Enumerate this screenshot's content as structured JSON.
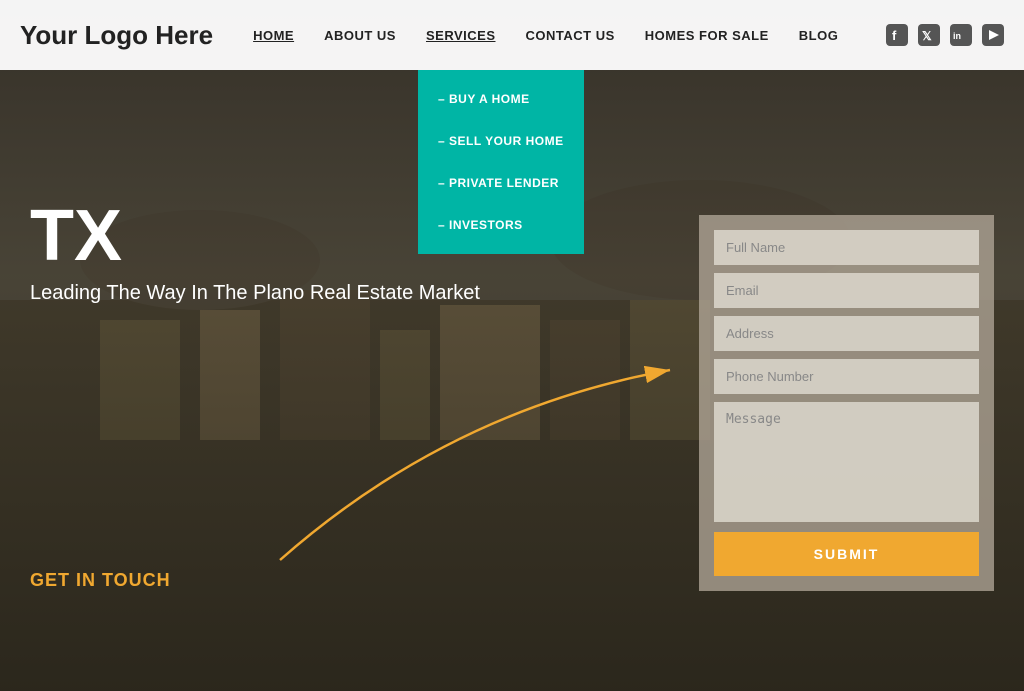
{
  "logo": {
    "text": "Your Logo Here"
  },
  "navbar": {
    "links": [
      {
        "label": "HOME",
        "id": "home",
        "active": true
      },
      {
        "label": "ABOUT US",
        "id": "about"
      },
      {
        "label": "SERVICES",
        "id": "services",
        "underline": true
      },
      {
        "label": "CONTACT US",
        "id": "contact"
      },
      {
        "label": "HOMES FOR SALE",
        "id": "homes"
      },
      {
        "label": "BLOG",
        "id": "blog"
      }
    ],
    "icons": [
      {
        "name": "facebook-icon",
        "symbol": "f"
      },
      {
        "name": "twitter-icon",
        "symbol": "t"
      },
      {
        "name": "linkedin-icon",
        "symbol": "in"
      },
      {
        "name": "youtube-icon",
        "symbol": "▶"
      }
    ]
  },
  "dropdown": {
    "items": [
      {
        "label": "– BUY A HOME"
      },
      {
        "label": "– SELL YOUR HOME"
      },
      {
        "label": "– PRIVATE LENDER"
      },
      {
        "label": "– INVESTORS"
      }
    ]
  },
  "hero": {
    "tx_text": "TX",
    "subtitle": "Leading The Way In The Plano Real Estate Market",
    "cta": "GET IN TOUCH"
  },
  "form": {
    "fields": [
      {
        "placeholder": "Full Name",
        "type": "text",
        "name": "full-name-input"
      },
      {
        "placeholder": "Email",
        "type": "email",
        "name": "email-input"
      },
      {
        "placeholder": "Address",
        "type": "text",
        "name": "address-input"
      },
      {
        "placeholder": "Phone Number",
        "type": "tel",
        "name": "phone-input"
      }
    ],
    "message_placeholder": "Message",
    "submit_label": "SUBMIT"
  }
}
